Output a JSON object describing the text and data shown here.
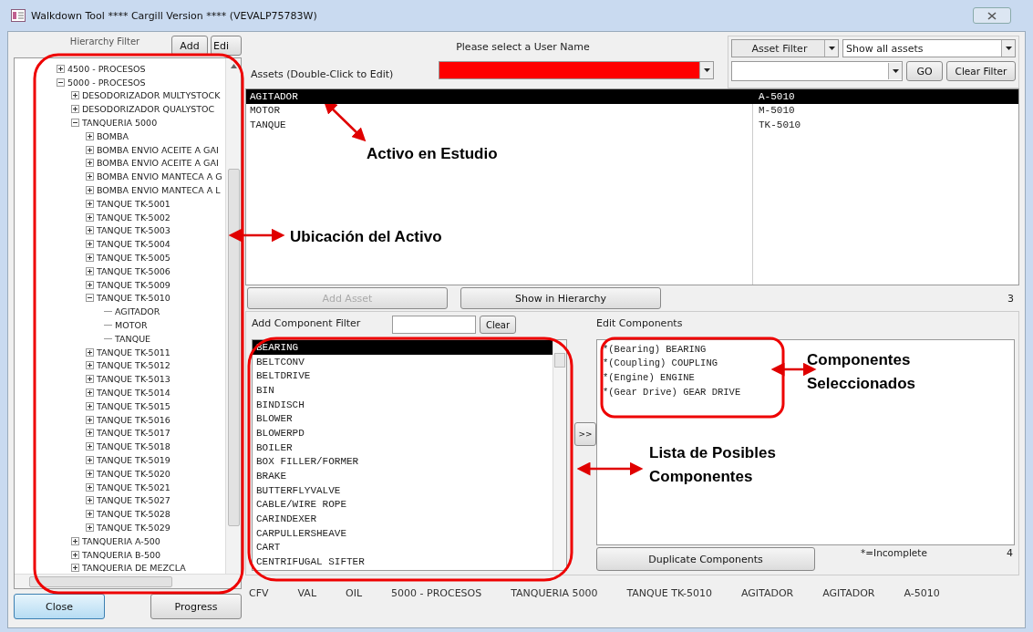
{
  "window": {
    "title": "Walkdown Tool **** Cargill Version ****  (VEVALP75783W)"
  },
  "hierarchy": {
    "label": "Hierarchy Filter",
    "add_button": "Add",
    "edit_button": "Edi",
    "tree": [
      {
        "label": "4500 - PROCESOS",
        "expanded": false
      },
      {
        "label": "5000 - PROCESOS",
        "expanded": true,
        "children": [
          {
            "label": "DESODORIZADOR MULTYSTOCK",
            "expanded": false
          },
          {
            "label": "DESODORIZADOR QUALYSTOC",
            "expanded": false
          },
          {
            "label": "TANQUERIA 5000",
            "expanded": true,
            "children": [
              {
                "label": "BOMBA",
                "expanded": false
              },
              {
                "label": "BOMBA ENVIO ACEITE  A GAI",
                "expanded": false
              },
              {
                "label": "BOMBA ENVIO ACEITE A  GAI",
                "expanded": false
              },
              {
                "label": "BOMBA ENVIO MANTECA A G",
                "expanded": false
              },
              {
                "label": "BOMBA ENVIO MANTECA A L",
                "expanded": false
              },
              {
                "label": "TANQUE TK-5001",
                "expanded": false
              },
              {
                "label": "TANQUE TK-5002",
                "expanded": false
              },
              {
                "label": "TANQUE TK-5003",
                "expanded": false
              },
              {
                "label": "TANQUE TK-5004",
                "expanded": false
              },
              {
                "label": "TANQUE TK-5005",
                "expanded": false
              },
              {
                "label": "TANQUE TK-5006",
                "expanded": false
              },
              {
                "label": "TANQUE TK-5009",
                "expanded": false
              },
              {
                "label": "TANQUE TK-5010",
                "expanded": true,
                "children": [
                  {
                    "label": "AGITADOR"
                  },
                  {
                    "label": "MOTOR"
                  },
                  {
                    "label": "TANQUE"
                  }
                ]
              },
              {
                "label": "TANQUE TK-5011",
                "expanded": false
              },
              {
                "label": "TANQUE TK-5012",
                "expanded": false
              },
              {
                "label": "TANQUE TK-5013",
                "expanded": false
              },
              {
                "label": "TANQUE TK-5014",
                "expanded": false
              },
              {
                "label": "TANQUE TK-5015",
                "expanded": false
              },
              {
                "label": "TANQUE TK-5016",
                "expanded": false
              },
              {
                "label": "TANQUE TK-5017",
                "expanded": false
              },
              {
                "label": "TANQUE TK-5018",
                "expanded": false
              },
              {
                "label": "TANQUE TK-5019",
                "expanded": false
              },
              {
                "label": "TANQUE TK-5020",
                "expanded": false
              },
              {
                "label": "TANQUE TK-5021",
                "expanded": false
              },
              {
                "label": "TANQUE TK-5027",
                "expanded": false
              },
              {
                "label": "TANQUE TK-5028",
                "expanded": false
              },
              {
                "label": "TANQUE TK-5029",
                "expanded": false
              }
            ]
          },
          {
            "label": "TANQUERIA A-500",
            "expanded": false
          },
          {
            "label": "TANQUERIA B-500",
            "expanded": false
          },
          {
            "label": "TANQUERIA DE MEZCLA",
            "expanded": false
          }
        ]
      }
    ]
  },
  "user_select": {
    "label": "Please select a User Name",
    "invalid": true
  },
  "assets": {
    "label": "Assets (Double-Click to Edit)",
    "rows": [
      {
        "name": "AGITADOR",
        "code": "A-5010",
        "selected": true
      },
      {
        "name": "MOTOR",
        "code": "M-5010",
        "selected": false
      },
      {
        "name": "TANQUE",
        "code": "TK-5010",
        "selected": false
      }
    ],
    "count": "3"
  },
  "asset_filter": {
    "type_label": "Asset Filter",
    "mode": "Show all assets",
    "go_button": "GO",
    "clear_button": "Clear Filter"
  },
  "asset_buttons": {
    "add": {
      "label": "Add Asset",
      "disabled": true
    },
    "show": {
      "label": "Show in Hierarchy",
      "disabled": false
    }
  },
  "component_filter": {
    "label": "Add Component Filter",
    "clear_button": "Clear"
  },
  "components": [
    {
      "label": "BEARING",
      "selected": true
    },
    {
      "label": "BELTCONV",
      "selected": false
    },
    {
      "label": "BELTDRIVE",
      "selected": false
    },
    {
      "label": "BIN",
      "selected": false
    },
    {
      "label": "BINDISCH",
      "selected": false
    },
    {
      "label": "BLOWER",
      "selected": false
    },
    {
      "label": "BLOWERPD",
      "selected": false
    },
    {
      "label": "BOILER",
      "selected": false
    },
    {
      "label": "BOX FILLER/FORMER",
      "selected": false
    },
    {
      "label": "BRAKE",
      "selected": false
    },
    {
      "label": "BUTTERFLYVALVE",
      "selected": false
    },
    {
      "label": "CABLE/WIRE ROPE",
      "selected": false
    },
    {
      "label": "CARINDEXER",
      "selected": false
    },
    {
      "label": "CARPULLERSHEAVE",
      "selected": false
    },
    {
      "label": "CART",
      "selected": false
    },
    {
      "label": "CENTRIFUGAL SIFTER",
      "selected": false
    }
  ],
  "move_button": ">>",
  "edit_components": {
    "label": "Edit Components",
    "items": [
      "*(Bearing) BEARING",
      "*(Coupling) COUPLING",
      "*(Engine) ENGINE",
      "*(Gear Drive) GEAR DRIVE"
    ],
    "duplicate_button": "Duplicate Components",
    "legend": "*=Incomplete",
    "count": "4"
  },
  "status_bar": [
    "CFV",
    "VAL",
    "OIL",
    "5000 - PROCESOS",
    "TANQUERIA 5000",
    "TANQUE TK-5010",
    "AGITADOR",
    "AGITADOR",
    "A-5010"
  ],
  "footer_buttons": [
    {
      "label": "Close",
      "focused": true
    },
    {
      "label": "Progress",
      "focused": false
    }
  ],
  "annotations": [
    "Activo en Estudio",
    "Ubicación del Activo",
    "Componentes Seleccionados",
    "Lista de Posibles Componentes"
  ]
}
